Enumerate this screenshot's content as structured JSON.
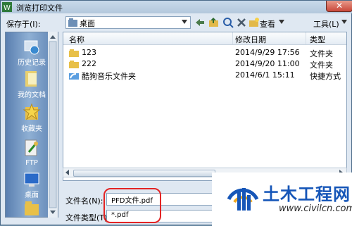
{
  "window": {
    "title": "浏览打印文件",
    "close_label": "✕"
  },
  "toolbar": {
    "save_in_label": "保存于(I):",
    "location": "桌面",
    "view_label": "查看",
    "tools_label": "工具(L)"
  },
  "sidebar": {
    "items": [
      {
        "label": "历史记录",
        "icon": "history-icon"
      },
      {
        "label": "我的文档",
        "icon": "documents-icon"
      },
      {
        "label": "收藏夹",
        "icon": "favorites-icon"
      },
      {
        "label": "FTP",
        "icon": "ftp-icon"
      },
      {
        "label": "桌面",
        "icon": "desktop-icon"
      }
    ]
  },
  "file_list": {
    "columns": [
      "名称",
      "修改日期",
      "类型"
    ],
    "rows": [
      {
        "name": "123",
        "date": "2014/9/29 17:56",
        "type": "文件夹",
        "icon": "folder-icon"
      },
      {
        "name": "222",
        "date": "2014/9/20 11:00",
        "type": "文件夹",
        "icon": "folder-icon"
      },
      {
        "name": "酷狗音乐文件夹",
        "date": "2014/6/1 15:11",
        "type": "快捷方式",
        "icon": "shortcut-icon"
      }
    ]
  },
  "filename": {
    "label": "文件名(N):",
    "value": "PFD文件.pdf"
  },
  "filetype": {
    "label": "文件类型(T):",
    "value": "*.pdf"
  },
  "watermark": {
    "title": "土木工程网",
    "url": "www.civilcn.com"
  },
  "colors": {
    "highlight": "#e32424",
    "watermark_blue": "#1656b8"
  }
}
